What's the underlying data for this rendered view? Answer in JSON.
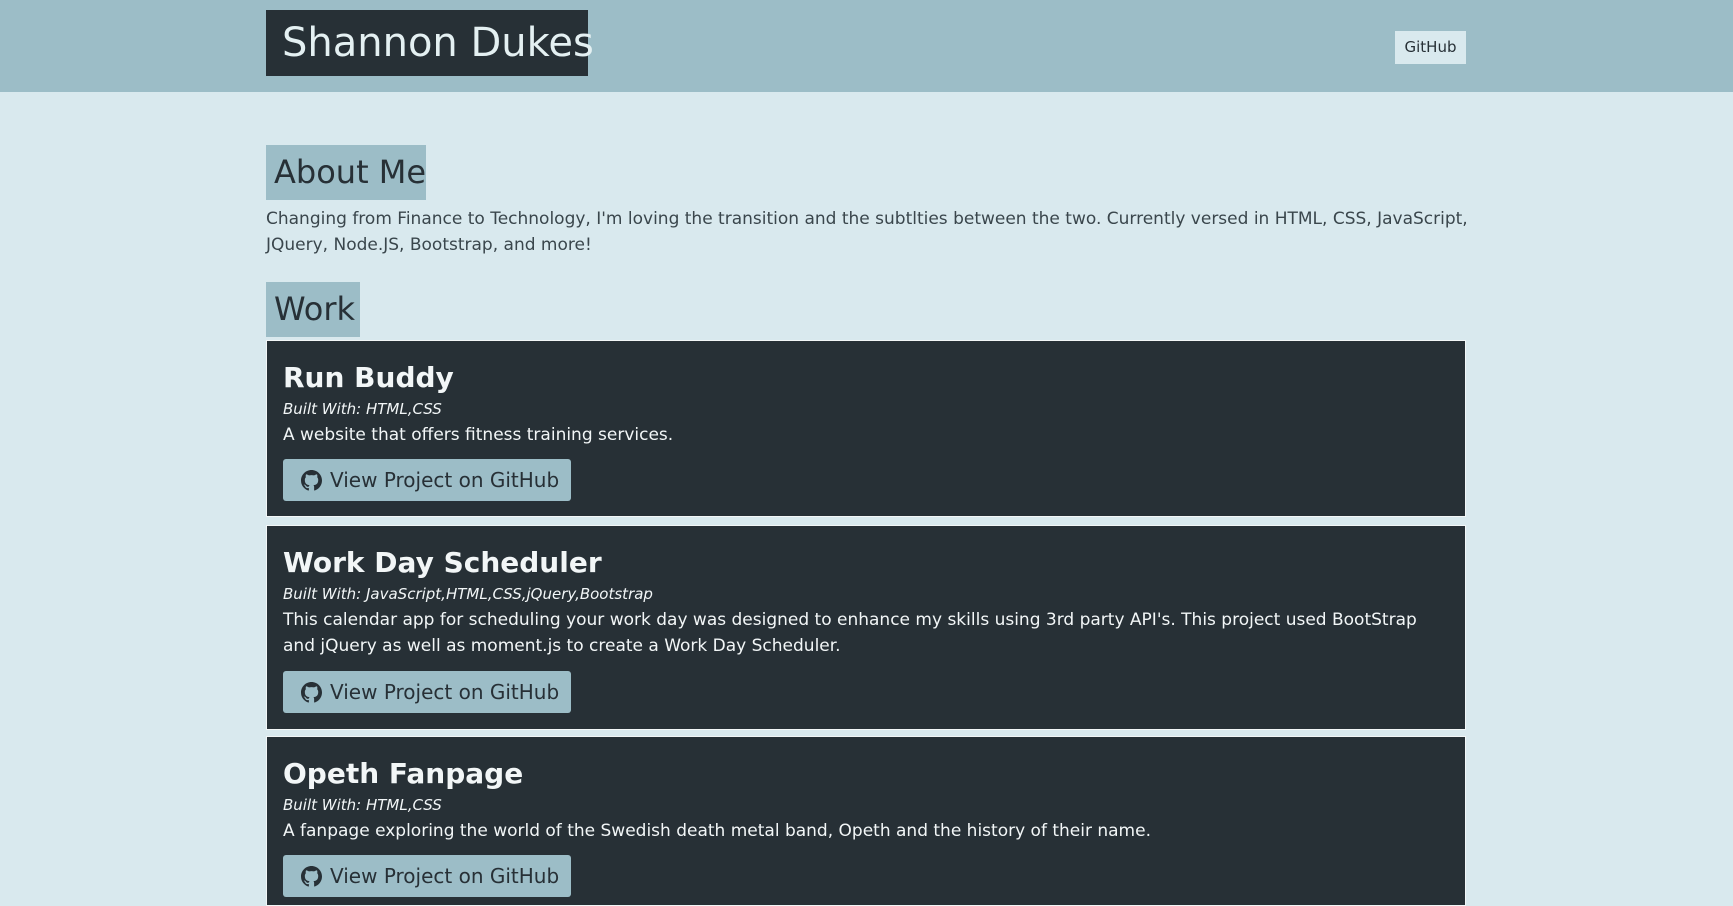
{
  "header": {
    "brand": "Shannon Dukes",
    "nav_github": "GitHub"
  },
  "about": {
    "heading": "About Me",
    "text": "Changing from Finance to Technology, I'm loving the transition and the subtlties between the two. Currently versed in HTML, CSS, JavaScript, JQuery, Node.JS, Bootstrap, and more!"
  },
  "work": {
    "heading": "Work",
    "projects": [
      {
        "title": "Run Buddy",
        "built_with": "Built With: HTML,CSS",
        "description": "A website that offers fitness training services.",
        "button_label": "View Project on GitHub",
        "button_icon": "github-icon"
      },
      {
        "title": "Work Day Scheduler",
        "built_with": "Built With: JavaScript,HTML,CSS,jQuery,Bootstrap",
        "description": "This calendar app for scheduling your work day was designed to enhance my skills using 3rd party API's. This project used BootStrap and jQuery as well as moment.js to create a Work Day Scheduler.",
        "button_label": "View Project on GitHub",
        "button_icon": "github-icon"
      },
      {
        "title": "Opeth Fanpage",
        "built_with": "Built With: HTML,CSS",
        "description": "A fanpage exploring the world of the Swedish death metal band, Opeth and the history of their name.",
        "button_label": "View Project on GitHub",
        "button_icon": "github-icon"
      }
    ]
  },
  "colors": {
    "page_background": "#d9e9ee",
    "accent": "#9cbdc7",
    "dark": "#273036",
    "light_text": "#f2f6f7"
  }
}
